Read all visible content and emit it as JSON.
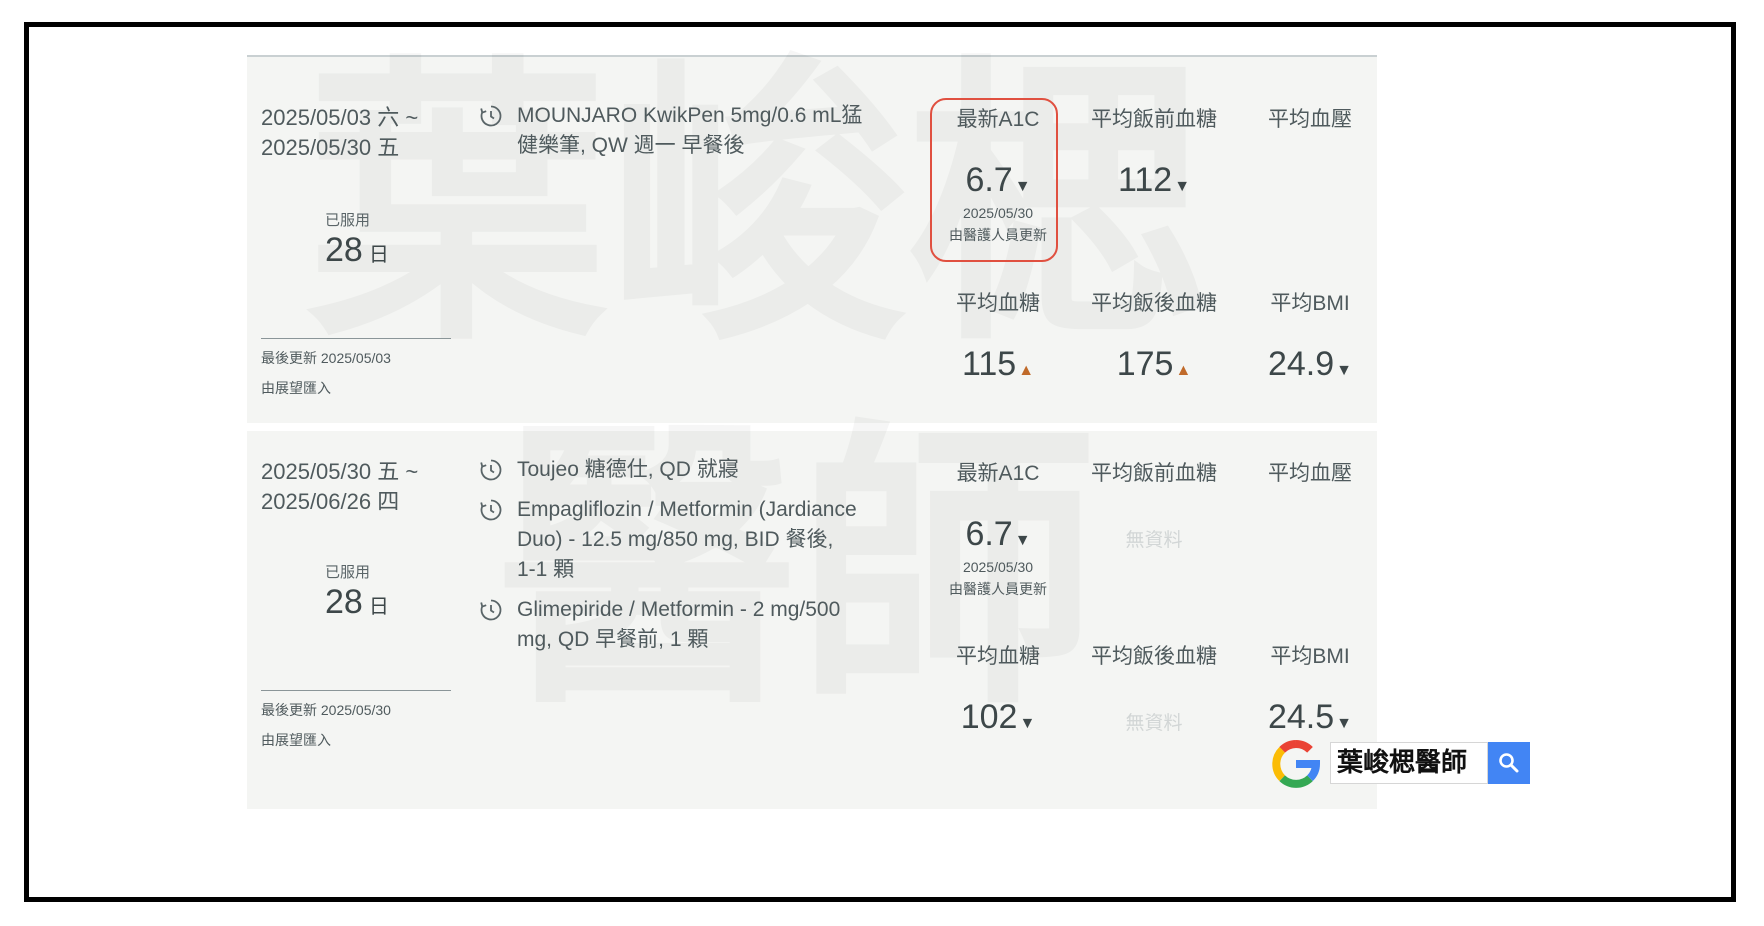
{
  "watermark": {
    "line1": "葉峻楒",
    "line2": "醫師"
  },
  "records": [
    {
      "period": [
        "2025/05/03 六 ~",
        "2025/05/30 五"
      ],
      "taken_label": "已服用",
      "taken_days": "28",
      "taken_unit": "日",
      "last_update": "最後更新 2025/05/03",
      "imported": "由展望匯入",
      "medications": [
        [
          "MOUNJARO KwikPen 5mg/0.6 mL猛",
          "健樂筆, QW 週一 早餐後"
        ]
      ],
      "stats": {
        "a1c": {
          "label": "最新A1C",
          "value": "6.7",
          "trend": "down",
          "date": "2025/05/30",
          "note": "由醫護人員更新"
        },
        "fasting": {
          "label": "平均飯前血糖",
          "value": "112",
          "trend": "down"
        },
        "bp": {
          "label": "平均血壓"
        },
        "glucose": {
          "label": "平均血糖",
          "value": "115",
          "trend": "up"
        },
        "postmeal": {
          "label": "平均飯後血糖",
          "value": "175",
          "trend": "up"
        },
        "bmi": {
          "label": "平均BMI",
          "value": "24.9",
          "trend": "down"
        }
      }
    },
    {
      "period": [
        "2025/05/30 五 ~",
        "2025/06/26 四"
      ],
      "taken_label": "已服用",
      "taken_days": "28",
      "taken_unit": "日",
      "last_update": "最後更新 2025/05/30",
      "imported": "由展望匯入",
      "medications": [
        [
          "Toujeo 糖德仕, QD 就寢"
        ],
        [
          "Empagliflozin / Metformin (Jardiance",
          "Duo) - 12.5 mg/850 mg, BID 餐後,",
          "1-1 顆"
        ],
        [
          "Glimepiride / Metformin - 2 mg/500",
          "mg, QD 早餐前, 1 顆"
        ]
      ],
      "stats": {
        "a1c": {
          "label": "最新A1C",
          "value": "6.7",
          "trend": "down",
          "date": "2025/05/30",
          "note": "由醫護人員更新"
        },
        "fasting": {
          "label": "平均飯前血糖",
          "nodata": "無資料"
        },
        "bp": {
          "label": "平均血壓"
        },
        "glucose": {
          "label": "平均血糖",
          "value": "102",
          "trend": "down"
        },
        "postmeal": {
          "label": "平均飯後血糖",
          "nodata": "無資料"
        },
        "bmi": {
          "label": "平均BMI",
          "value": "24.5",
          "trend": "down"
        }
      }
    }
  ],
  "search_badge": {
    "text": "葉峻楒醫師",
    "icon": "search-icon",
    "logo": "google-logo-icon"
  },
  "colors": {
    "card_bg": "#f4f5f3",
    "highlight": "#e05040",
    "up": "#c06a2a",
    "google_blue": "#4285f4"
  }
}
